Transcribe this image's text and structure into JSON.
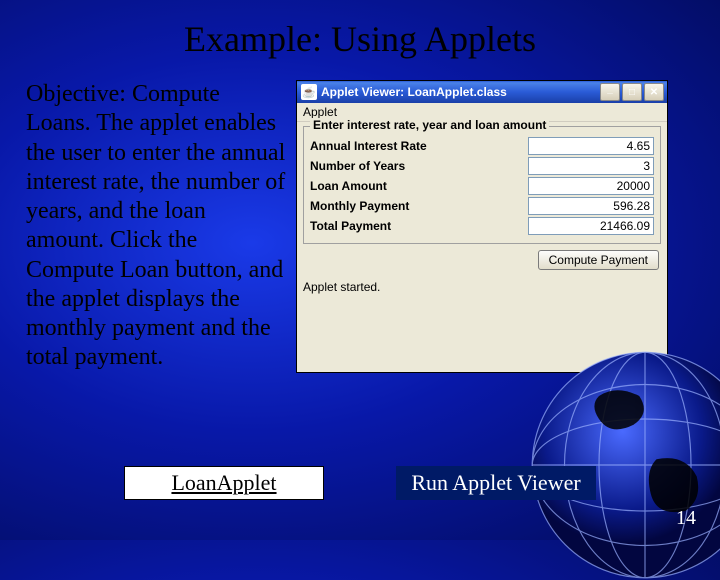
{
  "slide": {
    "title": "Example:  Using Applets",
    "objective": "Objective: Compute Loans. The applet enables the user to enter the annual interest rate, the number of years, and the loan amount. Click the Compute Loan button, and the applet displays the monthly payment and the total payment.",
    "page_number": "14",
    "buttons": {
      "loan_applet": "LoanApplet",
      "run_viewer": "Run Applet Viewer"
    }
  },
  "window": {
    "title": "Applet Viewer: LoanApplet.class",
    "menu_applet": "Applet",
    "group_title": "Enter interest rate, year and loan amount",
    "rows": {
      "rate_label": "Annual Interest Rate",
      "rate_value": "4.65",
      "years_label": "Number of Years",
      "years_value": "3",
      "amount_label": "Loan Amount",
      "amount_value": "20000",
      "monthly_label": "Monthly Payment",
      "monthly_value": "596.28",
      "total_label": "Total Payment",
      "total_value": "21466.09"
    },
    "compute_label": "Compute Payment",
    "status": "Applet started."
  },
  "icons": {
    "minimize": "__",
    "maximize": "□",
    "close": "✕"
  }
}
